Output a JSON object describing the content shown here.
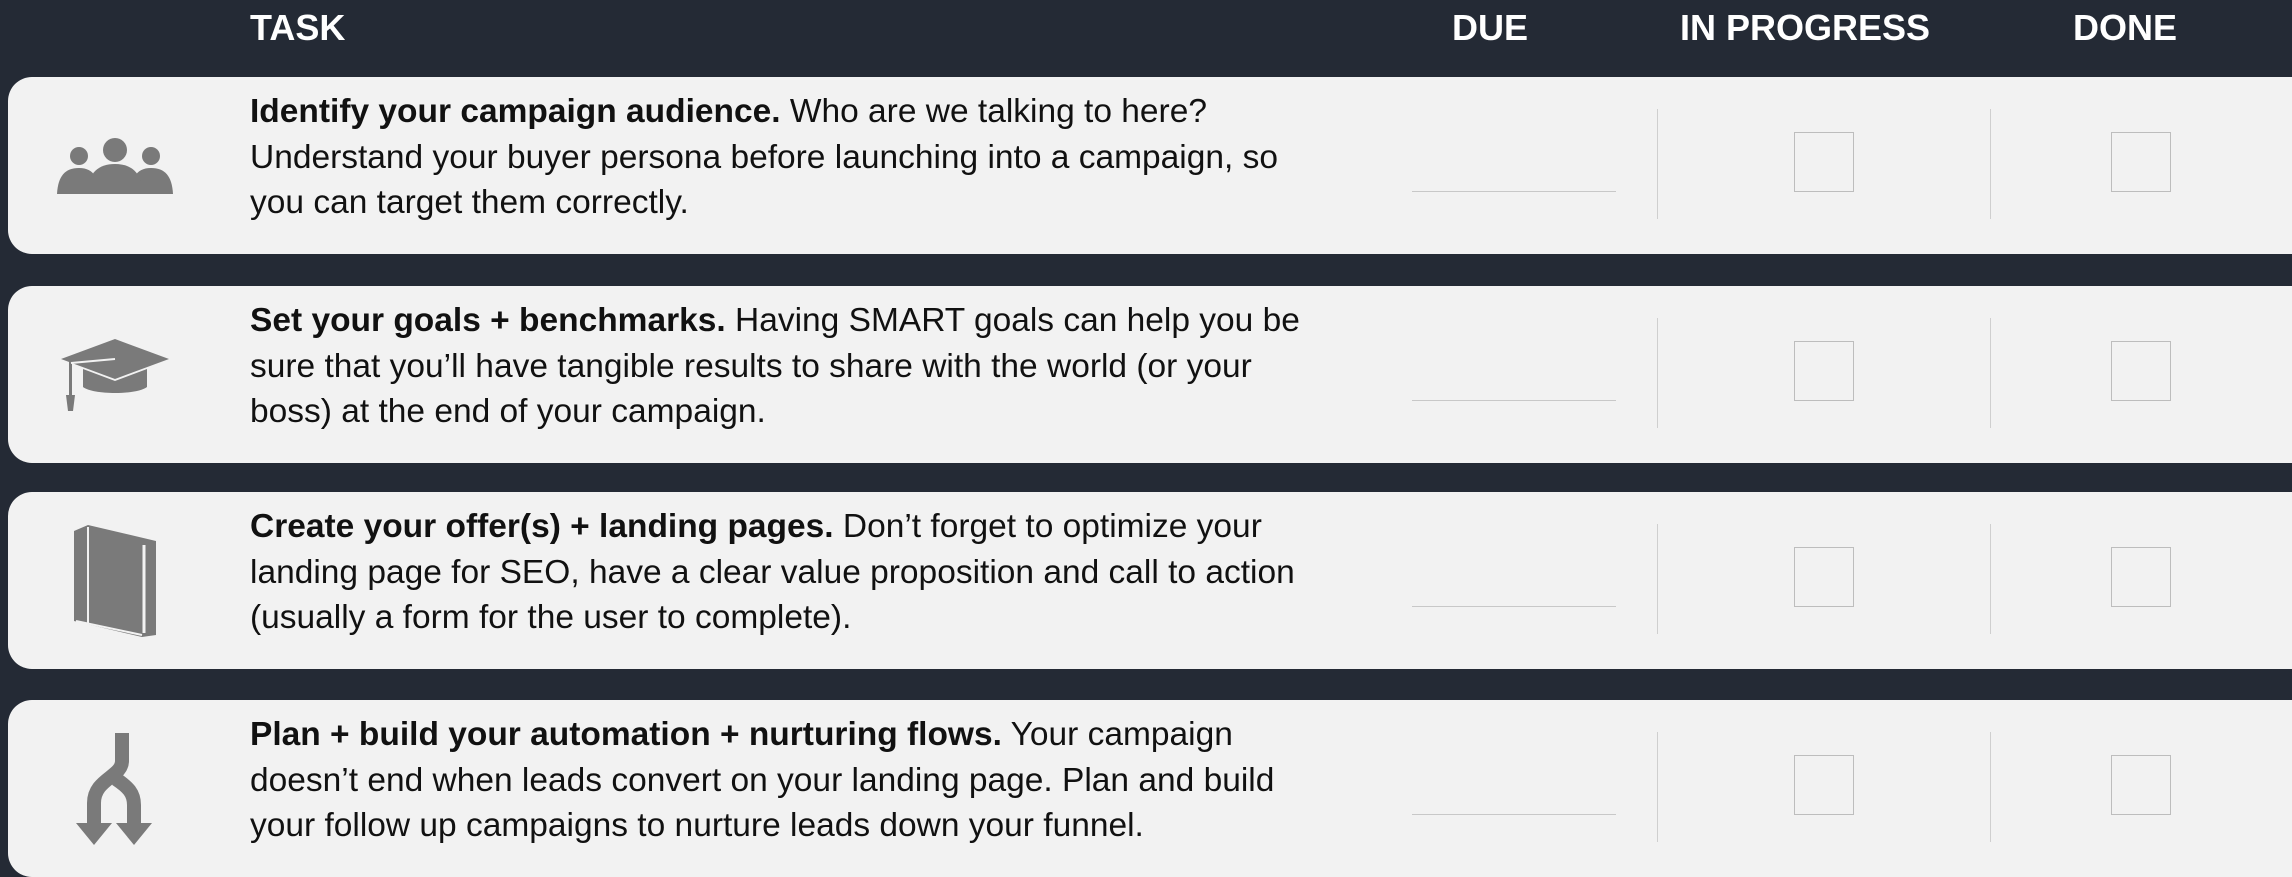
{
  "header": {
    "task": "TASK",
    "due": "DUE",
    "in_progress": "IN PROGRESS",
    "done": "DONE"
  },
  "tasks": [
    {
      "icon": "people-group-icon",
      "title": "Identify your campaign audience.",
      "body": " Who are we talking to here? Understand your buyer persona before launching into a campaign, so you can target them correctly."
    },
    {
      "icon": "graduation-cap-icon",
      "title": "Set your goals + benchmarks.",
      "body": " Having SMART goals can help you be sure that you’ll have tangible results to share with the world (or your boss) at the end of your campaign."
    },
    {
      "icon": "book-icon",
      "title": "Create your offer(s) + landing pages.",
      "body": " Don’t forget to optimize your landing page for SEO, have a clear value proposition and call to action (usually a form for the user to complete)."
    },
    {
      "icon": "split-arrows-icon",
      "title": "Plan + build your automation + nurturing flows.",
      "body": " Your campaign doesn’t end when leads convert on your landing page. Plan and build your follow up campaigns to nurture leads down your funnel."
    }
  ],
  "colors": {
    "background": "#242a35",
    "row": "#f2f2f2",
    "icon": "#7a7a7a",
    "text": "#111111"
  }
}
